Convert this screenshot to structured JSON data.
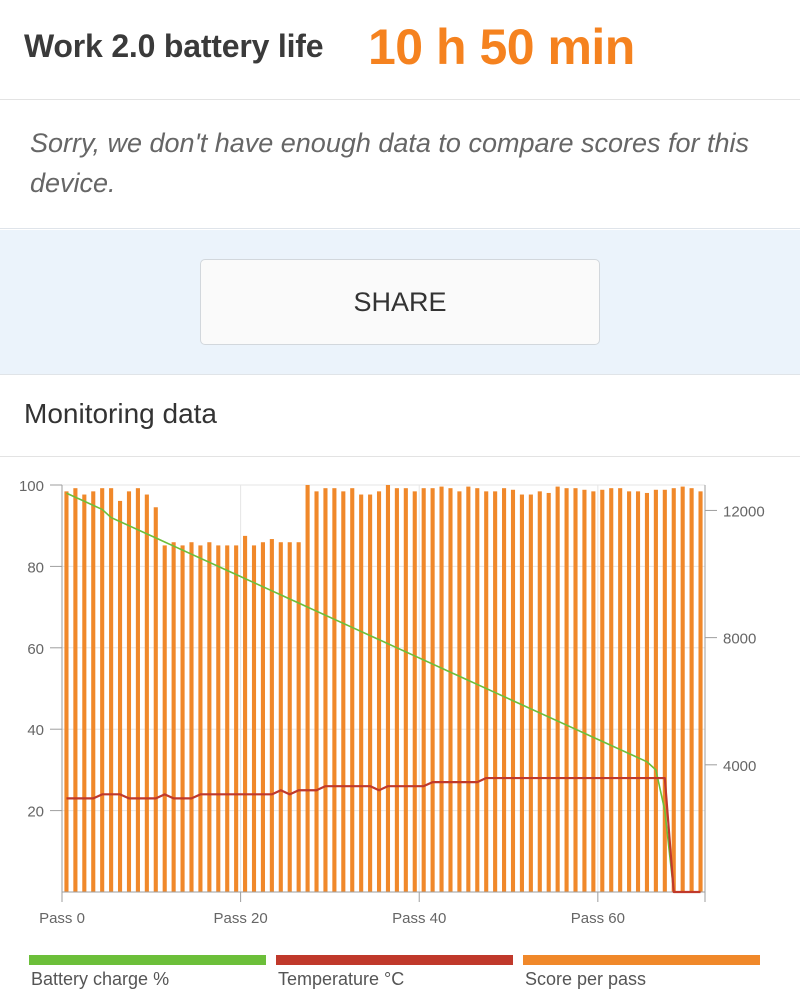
{
  "header": {
    "title": "Work 2.0 battery life",
    "value": "10 h 50 min"
  },
  "message": "Sorry, we don't have enough data to compare scores for this device.",
  "share": {
    "label": "SHARE"
  },
  "monitoring": {
    "title": "Monitoring data"
  },
  "colors": {
    "accent": "#f5821f",
    "battery": "#6cbf3a",
    "temperature": "#c0392b",
    "score": "#f0882a"
  },
  "legend": [
    {
      "label": "Battery charge %",
      "color": "#6cbf3a"
    },
    {
      "label": "Temperature °C",
      "color": "#c0392b"
    },
    {
      "label": "Score per pass",
      "color": "#f0882a"
    }
  ],
  "chart_data": {
    "type": "bar+line",
    "xlim": [
      0,
      72
    ],
    "x_tick_labels": [
      {
        "x": 0,
        "label": "Pass 0"
      },
      {
        "x": 20,
        "label": "Pass 20"
      },
      {
        "x": 40,
        "label": "Pass 40"
      },
      {
        "x": 60,
        "label": "Pass 60"
      }
    ],
    "y_left": {
      "ylim": [
        0,
        100
      ],
      "ticks": [
        20,
        40,
        60,
        80,
        100
      ],
      "tick_labels": [
        "20",
        "40",
        "60",
        "80",
        "100"
      ]
    },
    "y_right": {
      "ylim": [
        0,
        12800
      ],
      "ticks": [
        4000,
        8000,
        12000
      ],
      "tick_labels": [
        "4000",
        "8000",
        "12000"
      ]
    },
    "grid": true,
    "legend_position": "bottom",
    "series": [
      {
        "name": "Score per pass",
        "type": "bar",
        "axis": "right",
        "color": "#f0882a",
        "values": [
          12600,
          12700,
          12500,
          12600,
          12700,
          12700,
          12300,
          12600,
          12700,
          12500,
          12100,
          10900,
          11000,
          10900,
          11000,
          10900,
          11000,
          10900,
          10900,
          10900,
          11200,
          10900,
          11000,
          11100,
          11000,
          11000,
          11000,
          12800,
          12600,
          12700,
          12700,
          12600,
          12700,
          12500,
          12500,
          12600,
          12800,
          12700,
          12700,
          12600,
          12700,
          12700,
          12750,
          12700,
          12600,
          12750,
          12700,
          12600,
          12600,
          12700,
          12650,
          12500,
          12500,
          12600,
          12550,
          12750,
          12700,
          12700,
          12650,
          12600,
          12650,
          12700,
          12700,
          12600,
          12600,
          12550,
          12650,
          12650,
          12700,
          12750,
          12700,
          12600
        ]
      },
      {
        "name": "Battery charge %",
        "type": "line",
        "axis": "left",
        "color": "#6cbf3a",
        "values": [
          98,
          97,
          96,
          95,
          94,
          92,
          91,
          90,
          89,
          88,
          87,
          86,
          85,
          84,
          83,
          82,
          81,
          80,
          79,
          78,
          77,
          76,
          75,
          74,
          73,
          72,
          71,
          70,
          69,
          68,
          67,
          66,
          65,
          64,
          63,
          62,
          61,
          60,
          59,
          58,
          57,
          56,
          55,
          54,
          53,
          52,
          51,
          50,
          49,
          48,
          47,
          46,
          45,
          44,
          43,
          42,
          41,
          40,
          39,
          38,
          37,
          36,
          35,
          34,
          33,
          32,
          30,
          20,
          0,
          0,
          0,
          0
        ]
      },
      {
        "name": "Temperature °C",
        "type": "line",
        "axis": "left",
        "color": "#c0392b",
        "values": [
          23,
          23,
          23,
          23,
          24,
          24,
          24,
          23,
          23,
          23,
          23,
          24,
          23,
          23,
          23,
          24,
          24,
          24,
          24,
          24,
          24,
          24,
          24,
          24,
          25,
          24,
          25,
          25,
          25,
          26,
          26,
          26,
          26,
          26,
          26,
          25,
          26,
          26,
          26,
          26,
          26,
          27,
          27,
          27,
          27,
          27,
          27,
          28,
          28,
          28,
          28,
          28,
          28,
          28,
          28,
          28,
          28,
          28,
          28,
          28,
          28,
          28,
          28,
          28,
          28,
          28,
          28,
          28,
          0,
          0,
          0,
          0
        ]
      }
    ]
  }
}
